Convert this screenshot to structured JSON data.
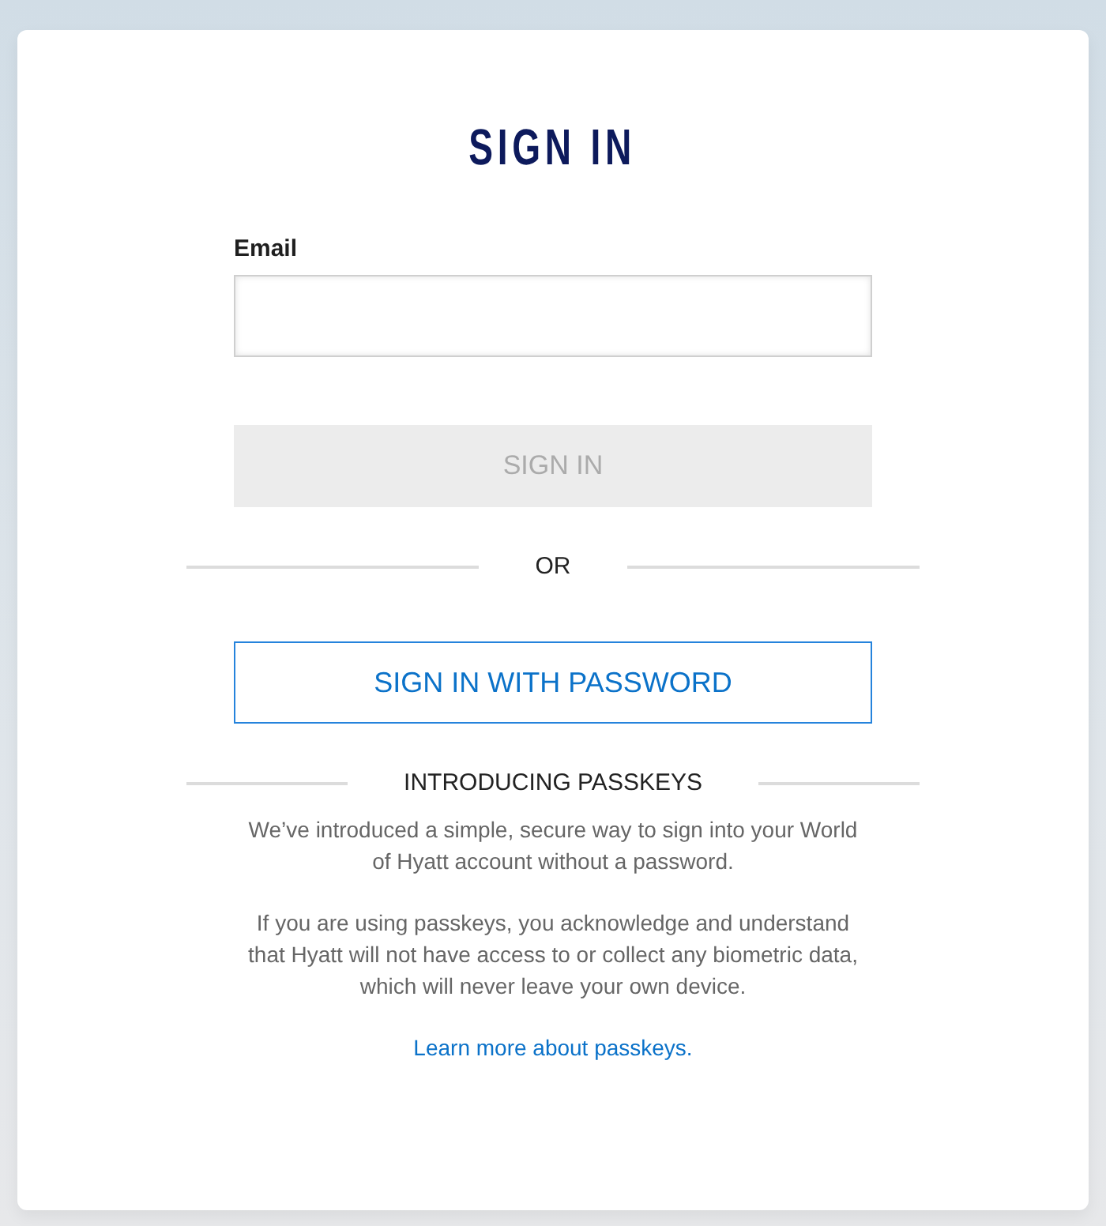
{
  "title": "SIGN IN",
  "email_field": {
    "label": "Email"
  },
  "sign_in_button": {
    "label": "SIGN IN",
    "disabled": true
  },
  "or_divider": "OR",
  "password_button": {
    "label": "SIGN IN WITH PASSWORD"
  },
  "passkeys": {
    "heading": "INTRODUCING PASSKEYS",
    "paragraphs": [
      "We’ve introduced a simple, secure way to sign into your World of Hyatt account without a password.",
      "If you are using passkeys, you acknowledge and understand that Hyatt will not have access to or collect any biometric data, which will never leave your own device."
    ],
    "link": "Learn more about passkeys."
  }
}
